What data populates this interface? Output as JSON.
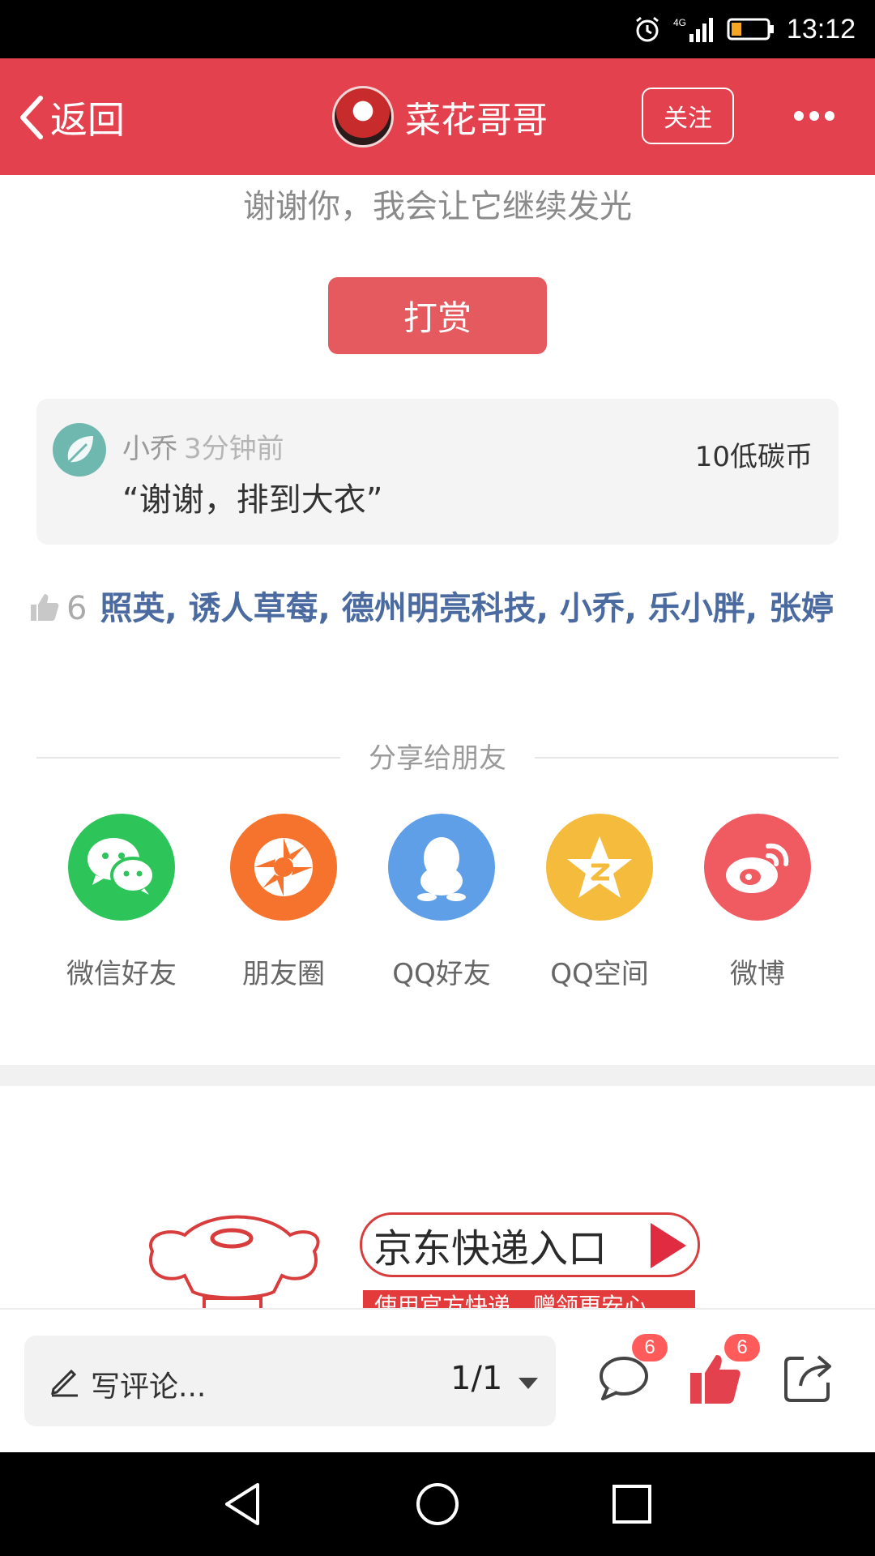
{
  "status_bar": {
    "time": "13:12",
    "network": "4G",
    "battery_color": "#f5a623"
  },
  "header": {
    "back_label": "返回",
    "author_name": "菜花哥哥",
    "follow_label": "关注",
    "bg_color": "#e4414f"
  },
  "thanks_text": "谢谢你，我会让它继续发光",
  "reward_button": "打赏",
  "reward_record": {
    "name": "小乔",
    "time": "3分钟前",
    "amount": "10低碳币",
    "message": "“谢谢，排到大衣”"
  },
  "likes": {
    "count": "6",
    "names": "照英, 诱人草莓, 德州明亮科技, 小乔, 乐小胖, 张婷"
  },
  "share": {
    "title": "分享给朋友",
    "items": [
      {
        "label": "微信好友",
        "icon": "wechat-icon",
        "color": "#2dc55a"
      },
      {
        "label": "朋友圈",
        "icon": "moments-icon",
        "color": "#f5732c"
      },
      {
        "label": "QQ好友",
        "icon": "qq-icon",
        "color": "#5f9fe8"
      },
      {
        "label": "QQ空间",
        "icon": "qzone-icon",
        "color": "#f5bb3d"
      },
      {
        "label": "微博",
        "icon": "weibo-icon",
        "color": "#f05a61"
      }
    ]
  },
  "ad": {
    "title": "京东快递入口",
    "subtitle": "使用官方快递，赠领更安心"
  },
  "bottom_bar": {
    "comment_placeholder": "写评论...",
    "page_indicator": "1/1",
    "comment_count": "6",
    "like_count": "6"
  }
}
